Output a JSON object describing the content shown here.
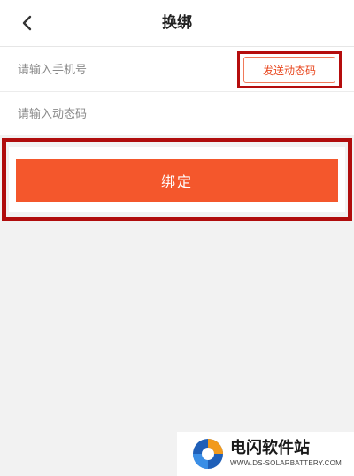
{
  "header": {
    "title": "换绑",
    "back_icon": "chevron-left-icon"
  },
  "form": {
    "phone_placeholder": "请输入手机号",
    "code_placeholder": "请输入动态码",
    "send_code_label": "发送动态码"
  },
  "actions": {
    "bind_label": "绑定"
  },
  "colors": {
    "accent": "#f4572c",
    "highlight_border": "#b00d0d",
    "send_text": "#e8471f",
    "background": "#f2f2f2"
  },
  "watermark": {
    "name": "电闪软件站",
    "url": "WWW.DS-SOLARBATTERY.COM",
    "logo_icon": "ds-logo-icon"
  }
}
